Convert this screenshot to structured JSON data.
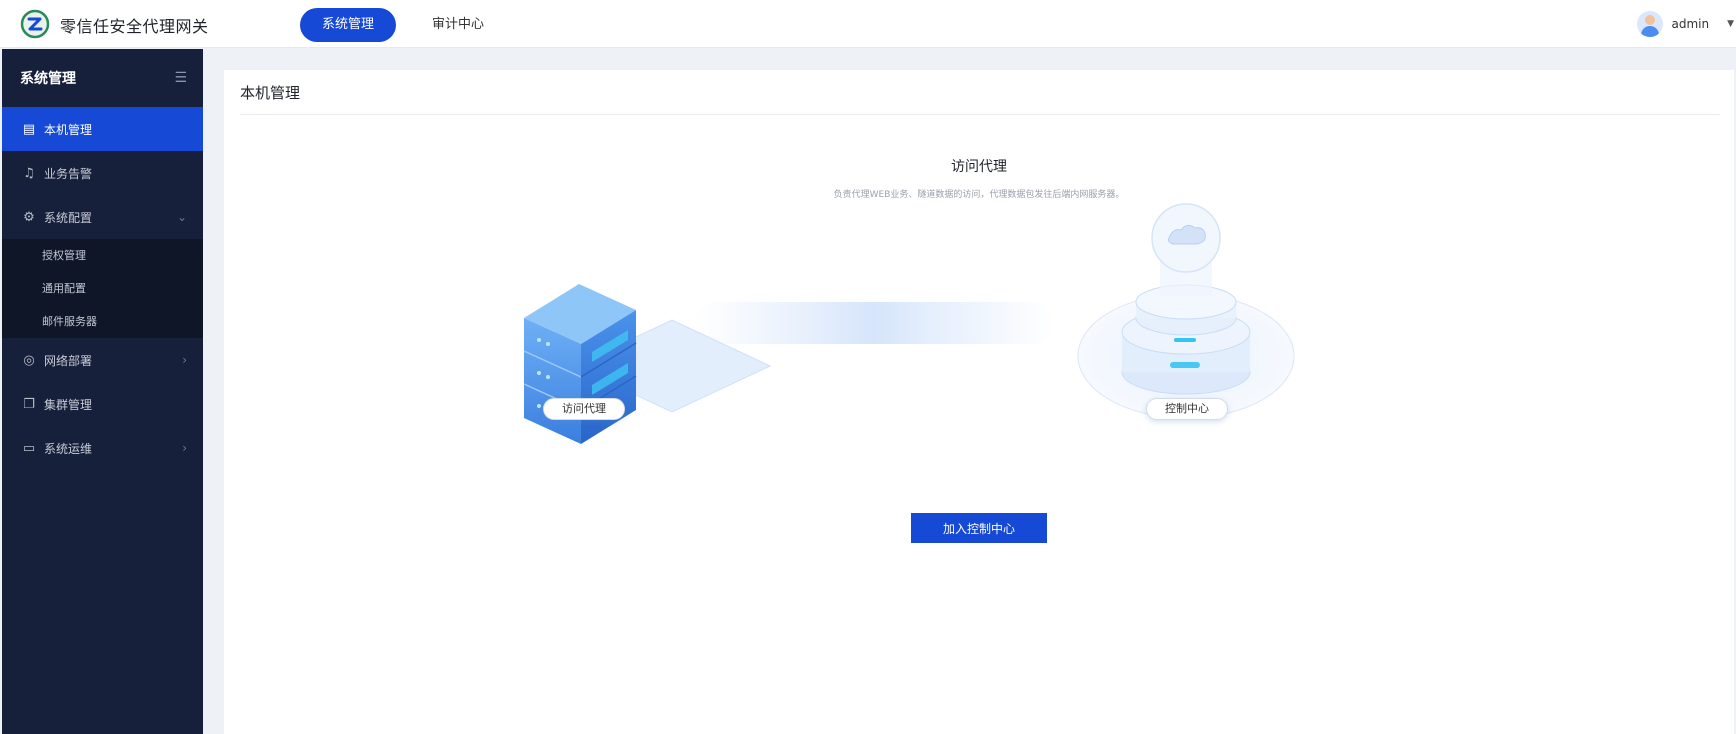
{
  "app": {
    "title": "零信任安全代理网关"
  },
  "topnav": {
    "tabs": [
      {
        "label": "系统管理",
        "active": true
      },
      {
        "label": "审计中心",
        "active": false
      }
    ]
  },
  "user": {
    "name": "admin"
  },
  "sidebar": {
    "title": "系统管理",
    "items": [
      {
        "label": "本机管理",
        "icon": "server-icon",
        "active": true
      },
      {
        "label": "业务告警",
        "icon": "bell-icon"
      },
      {
        "label": "系统配置",
        "icon": "gear-icon",
        "expanded": true,
        "children": [
          "授权管理",
          "通用配置",
          "邮件服务器"
        ]
      },
      {
        "label": "网络部署",
        "icon": "globe-icon"
      },
      {
        "label": "集群管理",
        "icon": "cluster-icon"
      },
      {
        "label": "系统运维",
        "icon": "monitor-icon"
      }
    ]
  },
  "main": {
    "page_title": "本机管理",
    "heading": "访问代理",
    "description": "负责代理WEB业务、隧道数据的访问，代理数据包发往后端内网服务器。",
    "left_node_label": "访问代理",
    "right_node_label": "控制中心",
    "join_button": "加入控制中心"
  },
  "colors": {
    "primary": "#1549d6",
    "sidebar": "#17203a",
    "submenu": "#0f1628"
  }
}
